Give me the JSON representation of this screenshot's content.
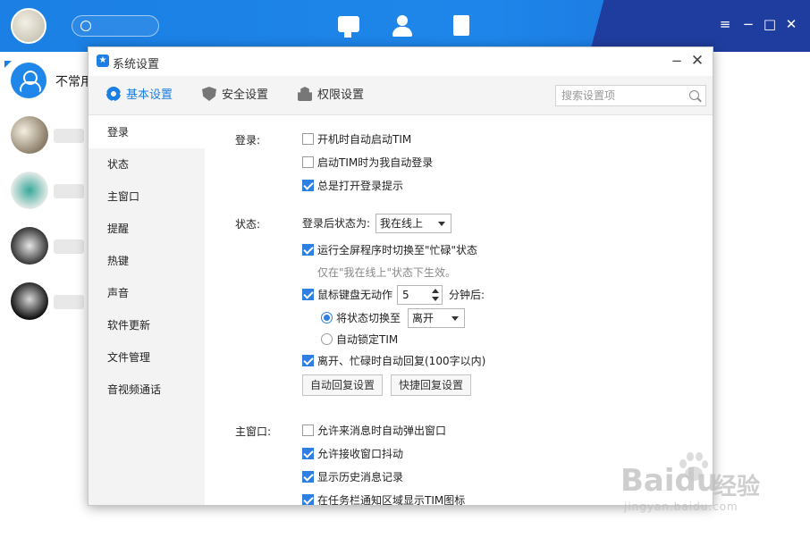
{
  "main_window": {
    "group_label": "不常用",
    "window_controls": [
      "≡",
      "−",
      "□",
      "✕"
    ]
  },
  "dialog": {
    "title": "系统设置",
    "minimize": "−",
    "close": "✕",
    "tabs": [
      {
        "label": "基本设置",
        "icon": "gear-icon",
        "active": true
      },
      {
        "label": "安全设置",
        "icon": "shield-icon",
        "active": false
      },
      {
        "label": "权限设置",
        "icon": "lock-icon",
        "active": false
      }
    ],
    "search": {
      "placeholder": "搜索设置项",
      "value": ""
    },
    "sidebar": [
      "登录",
      "状态",
      "主窗口",
      "提醒",
      "热键",
      "声音",
      "软件更新",
      "文件管理",
      "音视频通话"
    ],
    "sections": {
      "login": {
        "label": "登录:",
        "options": [
          {
            "label": "开机时自动启动TIM",
            "checked": false
          },
          {
            "label": "启动TIM时为我自动登录",
            "checked": false
          },
          {
            "label": "总是打开登录提示",
            "checked": true
          }
        ]
      },
      "status": {
        "label": "状态:",
        "after_login_label": "登录后状态为:",
        "after_login_value": "我在线上",
        "fullscreen_busy": {
          "label": "运行全屏程序时切换至\"忙碌\"状态",
          "checked": true
        },
        "fullscreen_hint": "仅在\"我在线上\"状态下生效。",
        "idle": {
          "label": "鼠标键盘无动作",
          "checked": true,
          "minutes": "5",
          "suffix": "分钟后:"
        },
        "switch_status": {
          "label": "将状态切换至",
          "selected": true,
          "value": "离开"
        },
        "auto_lock": {
          "label": "自动锁定TIM",
          "selected": false
        },
        "auto_reply": {
          "label": "离开、忙碌时自动回复(100字以内)",
          "checked": true
        },
        "buttons": [
          "自动回复设置",
          "快捷回复设置"
        ]
      },
      "main_window": {
        "label": "主窗口:",
        "options": [
          {
            "label": "允许来消息时自动弹出窗口",
            "checked": false
          },
          {
            "label": "允许接收窗口抖动",
            "checked": true
          },
          {
            "label": "显示历史消息记录",
            "checked": true
          },
          {
            "label": "在任务栏通知区域显示TIM图标",
            "checked": true
          }
        ]
      }
    }
  },
  "watermark": {
    "brand": "Baidu",
    "suffix": "经验",
    "url": "jingyan.baidu.com"
  },
  "colors": {
    "accent": "#1b7fe3",
    "checkbox": "#2f7fe0",
    "sidebar_bg": "#f3f3f3"
  }
}
